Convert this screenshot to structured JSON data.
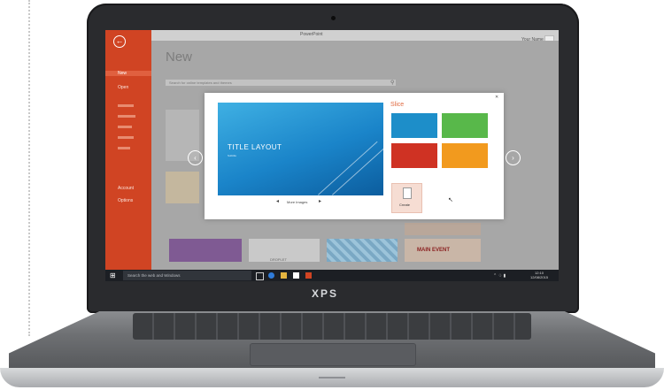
{
  "app": {
    "title": "PowerPoint",
    "user": "Your Name"
  },
  "backstage": {
    "back_icon": "back-arrow-icon",
    "items": [
      "New",
      "Open",
      "Account",
      "Options"
    ]
  },
  "backstage_page": {
    "title": "New",
    "search_placeholder": "Search for online templates and themes"
  },
  "dialog": {
    "preview_title": "TITLE LAYOUT",
    "preview_subtitle": "Subtitle",
    "more_images": "More Images",
    "theme_name": "Slice",
    "create_label": "Create",
    "close_icon": "close-icon",
    "variant_colors": [
      "#1d8ec9",
      "#58b84a",
      "#cf3223",
      "#f29a1e"
    ]
  },
  "templates": {
    "event_title": "MAIN EVENT",
    "dropout_label": "DROPLET"
  },
  "taskbar": {
    "search_placeholder": "Search the web and Windows",
    "time": "12:10",
    "date": "12/08/2015"
  },
  "device": {
    "brand": "XPS"
  }
}
